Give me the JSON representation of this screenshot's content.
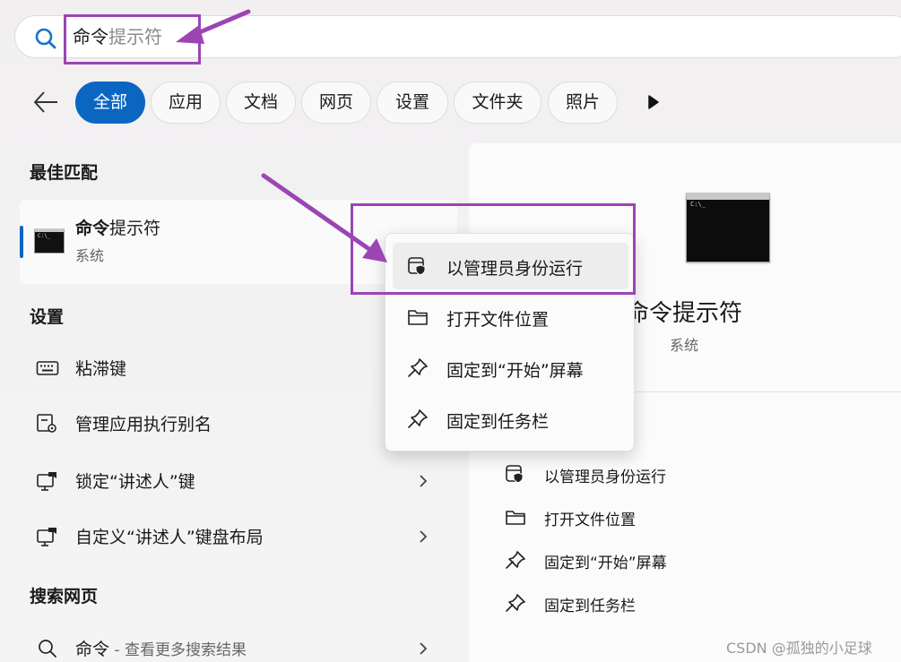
{
  "search": {
    "typed": "命令",
    "suggestion": "提示符"
  },
  "filters": {
    "tabs": [
      {
        "label": "全部",
        "active": true
      },
      {
        "label": "应用",
        "active": false
      },
      {
        "label": "文档",
        "active": false
      },
      {
        "label": "网页",
        "active": false
      },
      {
        "label": "设置",
        "active": false
      },
      {
        "label": "文件夹",
        "active": false
      },
      {
        "label": "照片",
        "active": false
      }
    ]
  },
  "best_match": {
    "section_title": "最佳匹配",
    "title_bold": "命令",
    "title_rest": "提示符",
    "subtitle": "系统",
    "icon": "cmd-icon"
  },
  "settings": {
    "section_title": "设置",
    "items": [
      {
        "label": "粘滞键",
        "icon": "keyboard-icon",
        "chevron": false
      },
      {
        "label": "管理应用执行别名",
        "icon": "app-settings-icon",
        "chevron": false
      },
      {
        "label": "锁定“讲述人”键",
        "icon": "narrator-icon",
        "chevron": true
      },
      {
        "label": "自定义“讲述人”键盘布局",
        "icon": "narrator-icon",
        "chevron": true
      }
    ]
  },
  "web": {
    "section_title": "搜索网页",
    "query": "命令",
    "hint": " - 查看更多搜索结果"
  },
  "context_menu": {
    "items": [
      {
        "label": "以管理员身份运行",
        "icon": "shield-icon"
      },
      {
        "label": "打开文件位置",
        "icon": "folder-icon"
      },
      {
        "label": "固定到“开始”屏幕",
        "icon": "pin-icon"
      },
      {
        "label": "固定到任务栏",
        "icon": "pin-icon"
      }
    ]
  },
  "detail": {
    "title": "命令提示符",
    "subtitle": "系统",
    "actions": [
      {
        "label": "以管理员身份运行",
        "icon": "shield-icon"
      },
      {
        "label": "打开文件位置",
        "icon": "folder-icon"
      },
      {
        "label": "固定到“开始”屏幕",
        "icon": "pin-icon"
      },
      {
        "label": "固定到任务栏",
        "icon": "pin-icon"
      }
    ]
  },
  "colors": {
    "accent": "#0b66c2",
    "annotation": "#9b45b4"
  },
  "watermark": "CSDN @孤独的小足球"
}
